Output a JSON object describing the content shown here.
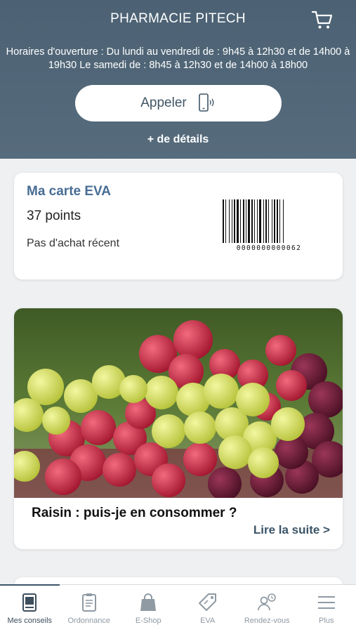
{
  "header": {
    "title": "PHARMACIE PITECH",
    "hours": "Horaires d'ouverture : Du lundi au vendredi de : 9h45 à 12h30 et de 14h00 à 19h30 Le samedi de : 8h45 à 12h30 et de 14h00 à 18h00",
    "call_label": "Appeler",
    "details_label": "+ de détails"
  },
  "eva_card": {
    "title": "Ma carte EVA",
    "points": "37 points",
    "status": "Pas d'achat récent",
    "barcode_number": "0000000000062"
  },
  "article": {
    "title": "Raisin : puis-je en consommer ?",
    "read_more": "Lire la suite >"
  },
  "tabs": [
    {
      "label": "Mes conseils",
      "icon": "book-icon",
      "active": true
    },
    {
      "label": "Ordonnance",
      "icon": "prescription-icon",
      "active": false
    },
    {
      "label": "E-Shop",
      "icon": "shopping-bag-icon",
      "active": false
    },
    {
      "label": "EVA",
      "icon": "tag-icon",
      "active": false
    },
    {
      "label": "Rendez-vous",
      "icon": "appointment-icon",
      "active": false
    },
    {
      "label": "Plus",
      "icon": "menu-icon",
      "active": false
    }
  ],
  "colors": {
    "header": "#4f6577",
    "accent_blue": "#486d94",
    "active_tab": "#3d4f5d",
    "inactive_tab": "#8f9aa3"
  }
}
